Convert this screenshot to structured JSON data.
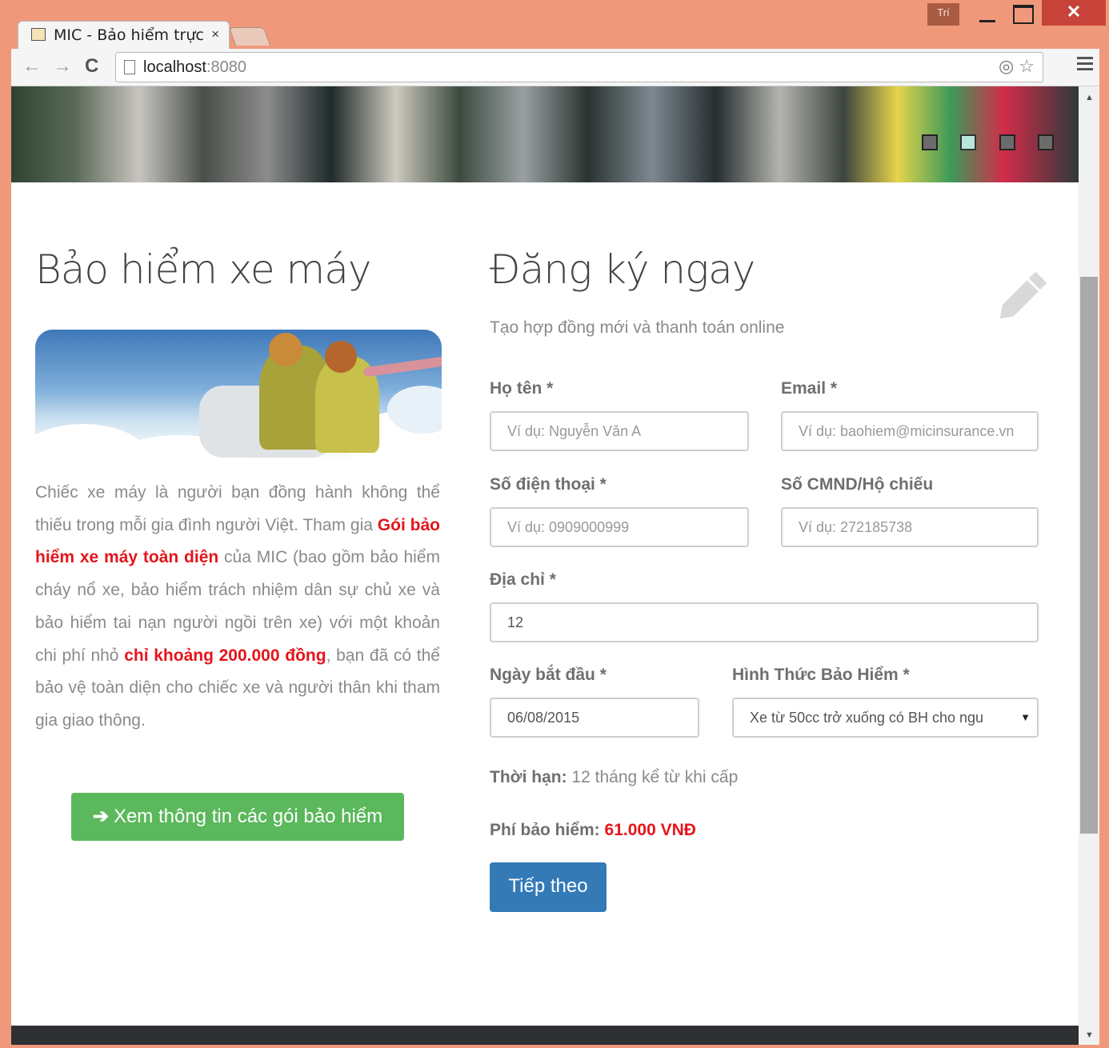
{
  "browser": {
    "tab_title": "MIC - Bảo hiểm trực",
    "tab_close": "×",
    "user_badge": "Trí",
    "win_close": "✕",
    "url_host": "localhost",
    "url_port": ":8080",
    "back": "←",
    "forward": "→",
    "reload": "C"
  },
  "banner": {
    "dots": 4,
    "active_dot": 2
  },
  "left": {
    "title": "Bảo hiểm xe máy",
    "desc_1": "Chiếc xe máy là người bạn đồng hành không thể thiếu trong mỗi gia đình người Việt.  Tham gia ",
    "desc_hl_1": "Gói bảo hiểm xe máy toàn diện",
    "desc_2": " của MIC (bao gồm bảo hiểm cháy nổ xe, bảo hiểm trách nhiệm dân sự chủ xe và bảo hiểm tai nạn người ngồi trên xe) với một khoản chi phí nhỏ ",
    "desc_hl_2": "chỉ khoảng 200.000 đồng",
    "desc_3": ", bạn đã có thể bảo vệ toàn diện cho chiếc xe và người thân khi tham gia giao thông.",
    "info_button": "Xem thông tin các gói bảo hiểm",
    "info_arrow": "➔"
  },
  "form": {
    "title": "Đăng ký ngay",
    "subtitle": "Tạo hợp đồng mới và thanh toán online",
    "name_label": "Họ tên *",
    "name_placeholder": "Ví dụ: Nguyễn Văn A",
    "email_label": "Email *",
    "email_placeholder": "Ví dụ: baohiem@micinsurance.vn",
    "phone_label": "Số điện thoại *",
    "phone_placeholder": "Ví dụ: 0909000999",
    "id_label": "Số CMND/Hộ chiếu",
    "id_placeholder": "Ví dụ: 272185738",
    "address_label": "Địa chỉ *",
    "address_value": "12",
    "start_label": "Ngày bắt đầu *",
    "start_value": "06/08/2015",
    "type_label": "Hình Thức Bảo Hiểm *",
    "type_value": "Xe từ 50cc trở xuống có BH cho ngu",
    "select_arrow": "▼",
    "term_label": "Thời hạn:",
    "term_value": " 12 tháng kể từ khi cấp",
    "fee_label": "Phí bảo hiểm:",
    "fee_value": " 61.000 VNĐ",
    "next_button": "Tiếp theo"
  }
}
